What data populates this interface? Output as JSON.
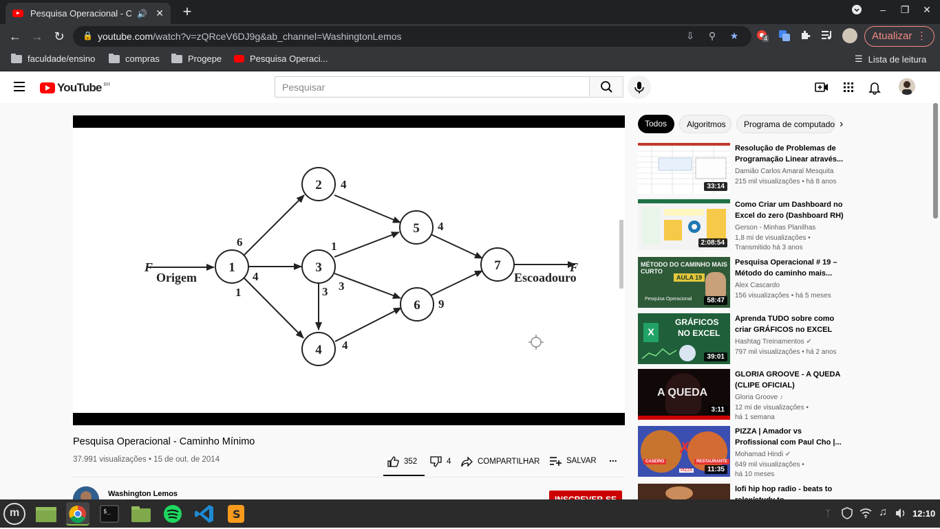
{
  "browser": {
    "tab_title": "Pesquisa Operacional - Ca",
    "url_domain": "youtube.com",
    "url_path": "/watch?v=zQRceV6DJ9g&ab_channel=WashingtonLemos",
    "update_label": "Atualizar",
    "ext_badge": "4"
  },
  "bookmarks": [
    {
      "label": "faculdade/ensino",
      "icon": "folder-icon"
    },
    {
      "label": "compras",
      "icon": "folder-icon"
    },
    {
      "label": "Progepe",
      "icon": "folder-icon"
    },
    {
      "label": "Pesquisa Operaci...",
      "icon": "youtube-icon"
    }
  ],
  "reading_list": "Lista de leitura",
  "youtube": {
    "logo_text": "YouTube",
    "region": "BR",
    "search_placeholder": "Pesquisar"
  },
  "video": {
    "title": "Pesquisa Operacional - Caminho Mínimo",
    "meta": "37.991 visualizações • 15 de out. de 2014",
    "likes": "352",
    "dislikes": "4",
    "share_label": "COMPARTILHAR",
    "save_label": "SALVAR",
    "more_label": "...",
    "channel": "Washington Lemos",
    "subscribe_label": "INSCREVER-SE"
  },
  "slide": {
    "left_label": "F",
    "origin_label": "Origem",
    "sink_label": "Escoadouro",
    "right_label": "F",
    "nodes": [
      "1",
      "2",
      "3",
      "4",
      "5",
      "6",
      "7"
    ],
    "edge_weights": {
      "e12": "6",
      "e13": "4",
      "e14": "1",
      "e25": "4",
      "e35": "1",
      "e36": "3",
      "e34": "3",
      "e46": "4",
      "e57": "4",
      "e67": "9"
    }
  },
  "chips": [
    "Todos",
    "Algoritmos",
    "Programa de computado"
  ],
  "recommendations": [
    {
      "title": "Resolução de Problemas de Programação Linear através...",
      "channel": "Damião Carlos Amaral Mesquita",
      "meta1": "215 mil visualizações • há 8 anos",
      "meta2": "",
      "duration": "33:14"
    },
    {
      "title": "Como Criar um Dashboard no Excel do zero (Dashboard RH)",
      "channel": "Gerson - Minhas Planilhas",
      "meta1": "1,8 mi de visualizações •",
      "meta2": "Transmitido há 3 anos",
      "duration": "2:08:54"
    },
    {
      "title": "Pesquisa Operacional # 19 – Método do caminho mais...",
      "channel": "Alex Cascardo",
      "meta1": "156 visualizações • há 5 meses",
      "meta2": "",
      "duration": "58:47",
      "thumb_line1": "MÉTODO DO CAMINHO MAIS",
      "thumb_line2": "CURTO",
      "thumb_badge": "AULA 19",
      "thumb_footer": "Pesquisa Operacional"
    },
    {
      "title": "Aprenda TUDO sobre como criar GRÁFICOS no EXCEL",
      "channel": "Hashtag Treinamentos",
      "meta1": "797 mil visualizações • há 2 anos",
      "meta2": "",
      "duration": "39:01",
      "thumb_line1": "GRÁFICOS",
      "thumb_line2": "NO EXCEL"
    },
    {
      "title": "GLORIA GROOVE - A QUEDA (CLIPE OFICIAL)",
      "channel": "Gloria Groove",
      "meta1": "12 mi de visualizações •",
      "meta2": "há 1 semana",
      "duration": "3:11",
      "thumb_line1": "A QUEDA"
    },
    {
      "title": "PIZZA | Amador vs Profissional com Paul Cho |...",
      "channel": "Mohamad Hindi",
      "meta1": "649 mil visualizações •",
      "meta2": "há 10 meses",
      "duration": "11:35",
      "thumb_line1": "CASEIRO",
      "thumb_line2": "PIZZA",
      "thumb_badge": "RESTAURANTE"
    },
    {
      "title": "lofi hip hop radio - beats to relax/study to",
      "channel": "",
      "meta1": "",
      "meta2": "",
      "duration": ""
    }
  ],
  "taskbar": {
    "clock": "12:10"
  }
}
